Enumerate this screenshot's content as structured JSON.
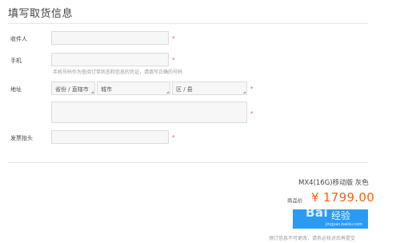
{
  "page": {
    "title": "填写取货信息"
  },
  "form": {
    "recipient_label": "收件人",
    "phone_label": "手机",
    "phone_hint": "手机号码作为查阅订单状态和信息的凭证，请填写正确的号码",
    "address_label": "地址",
    "province_placeholder": "省份 / 直辖市",
    "city_placeholder": "城市",
    "district_placeholder": "区 / 县",
    "invoice_label": "发票抬头",
    "required_mark": "*"
  },
  "order": {
    "product": "MX4(16G)移动版 灰色",
    "price_label": "商品价",
    "price": "¥ 1799.00",
    "submit_label": "",
    "note": "预订信息不可更改，请务必核对后再提交"
  },
  "watermark": {
    "brand": "Bai",
    "brand2": "经验",
    "url": "jingyan.baidu.com"
  }
}
